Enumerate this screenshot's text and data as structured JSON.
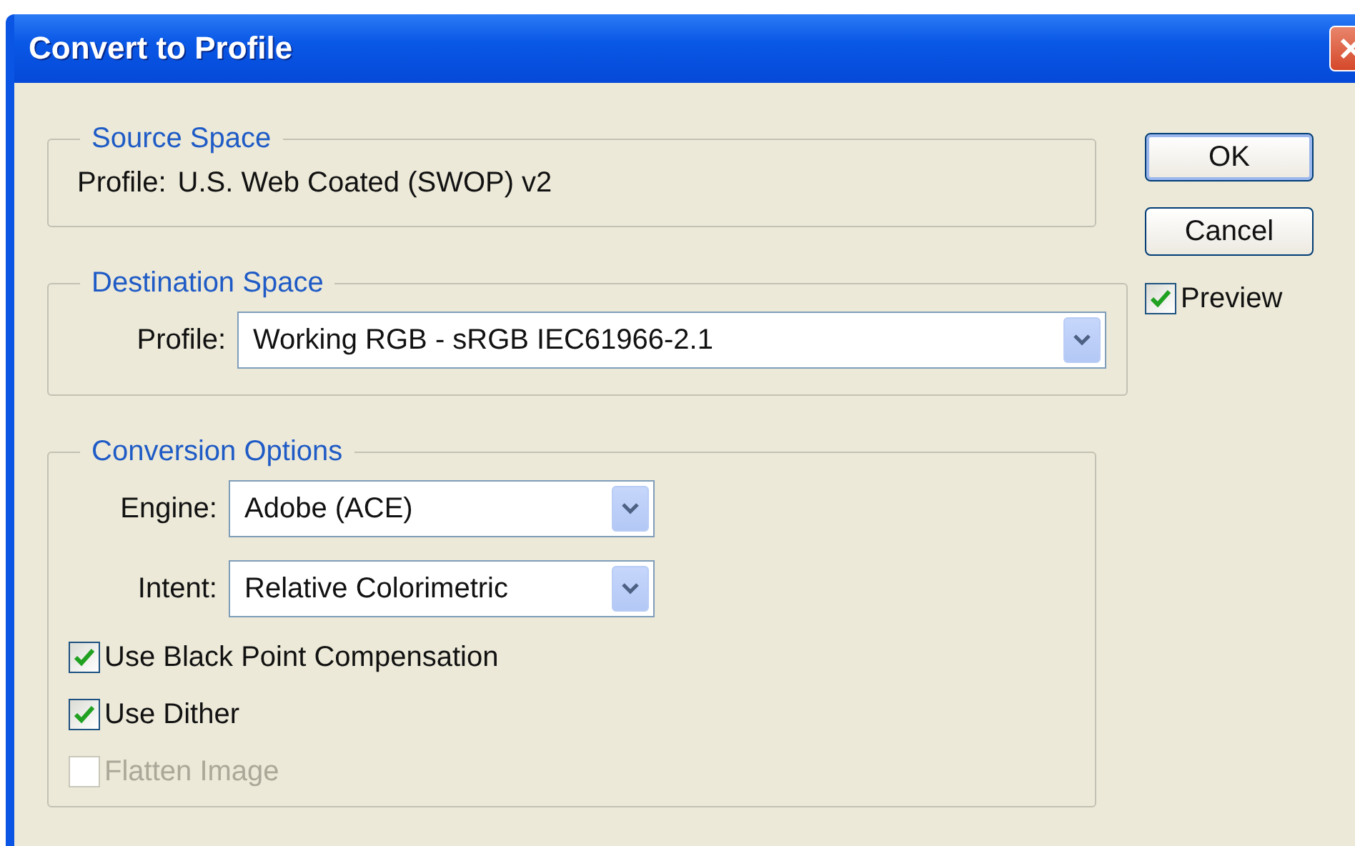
{
  "window": {
    "title": "Convert to Profile"
  },
  "source_space": {
    "title": "Source Space",
    "label": "Profile:",
    "value": "U.S. Web Coated (SWOP) v2"
  },
  "destination_space": {
    "title": "Destination Space",
    "fields": [
      {
        "label": "Profile:",
        "value": "Working RGB - sRGB IEC61966-2.1"
      }
    ]
  },
  "conversion_options": {
    "title": "Conversion Options",
    "fields": [
      {
        "label": "Engine:",
        "value": "Adobe (ACE)"
      },
      {
        "label": "Intent:",
        "value": "Relative Colorimetric"
      }
    ],
    "checkboxes": [
      {
        "label": "Use Black Point Compensation",
        "checked": true,
        "disabled": false
      },
      {
        "label": "Use Dither",
        "checked": true,
        "disabled": false
      },
      {
        "label": "Flatten Image",
        "checked": false,
        "disabled": true
      }
    ]
  },
  "buttons": [
    {
      "label": "OK",
      "default": true
    },
    {
      "label": "Cancel",
      "default": false
    }
  ],
  "preview": {
    "label": "Preview",
    "checked": true
  }
}
